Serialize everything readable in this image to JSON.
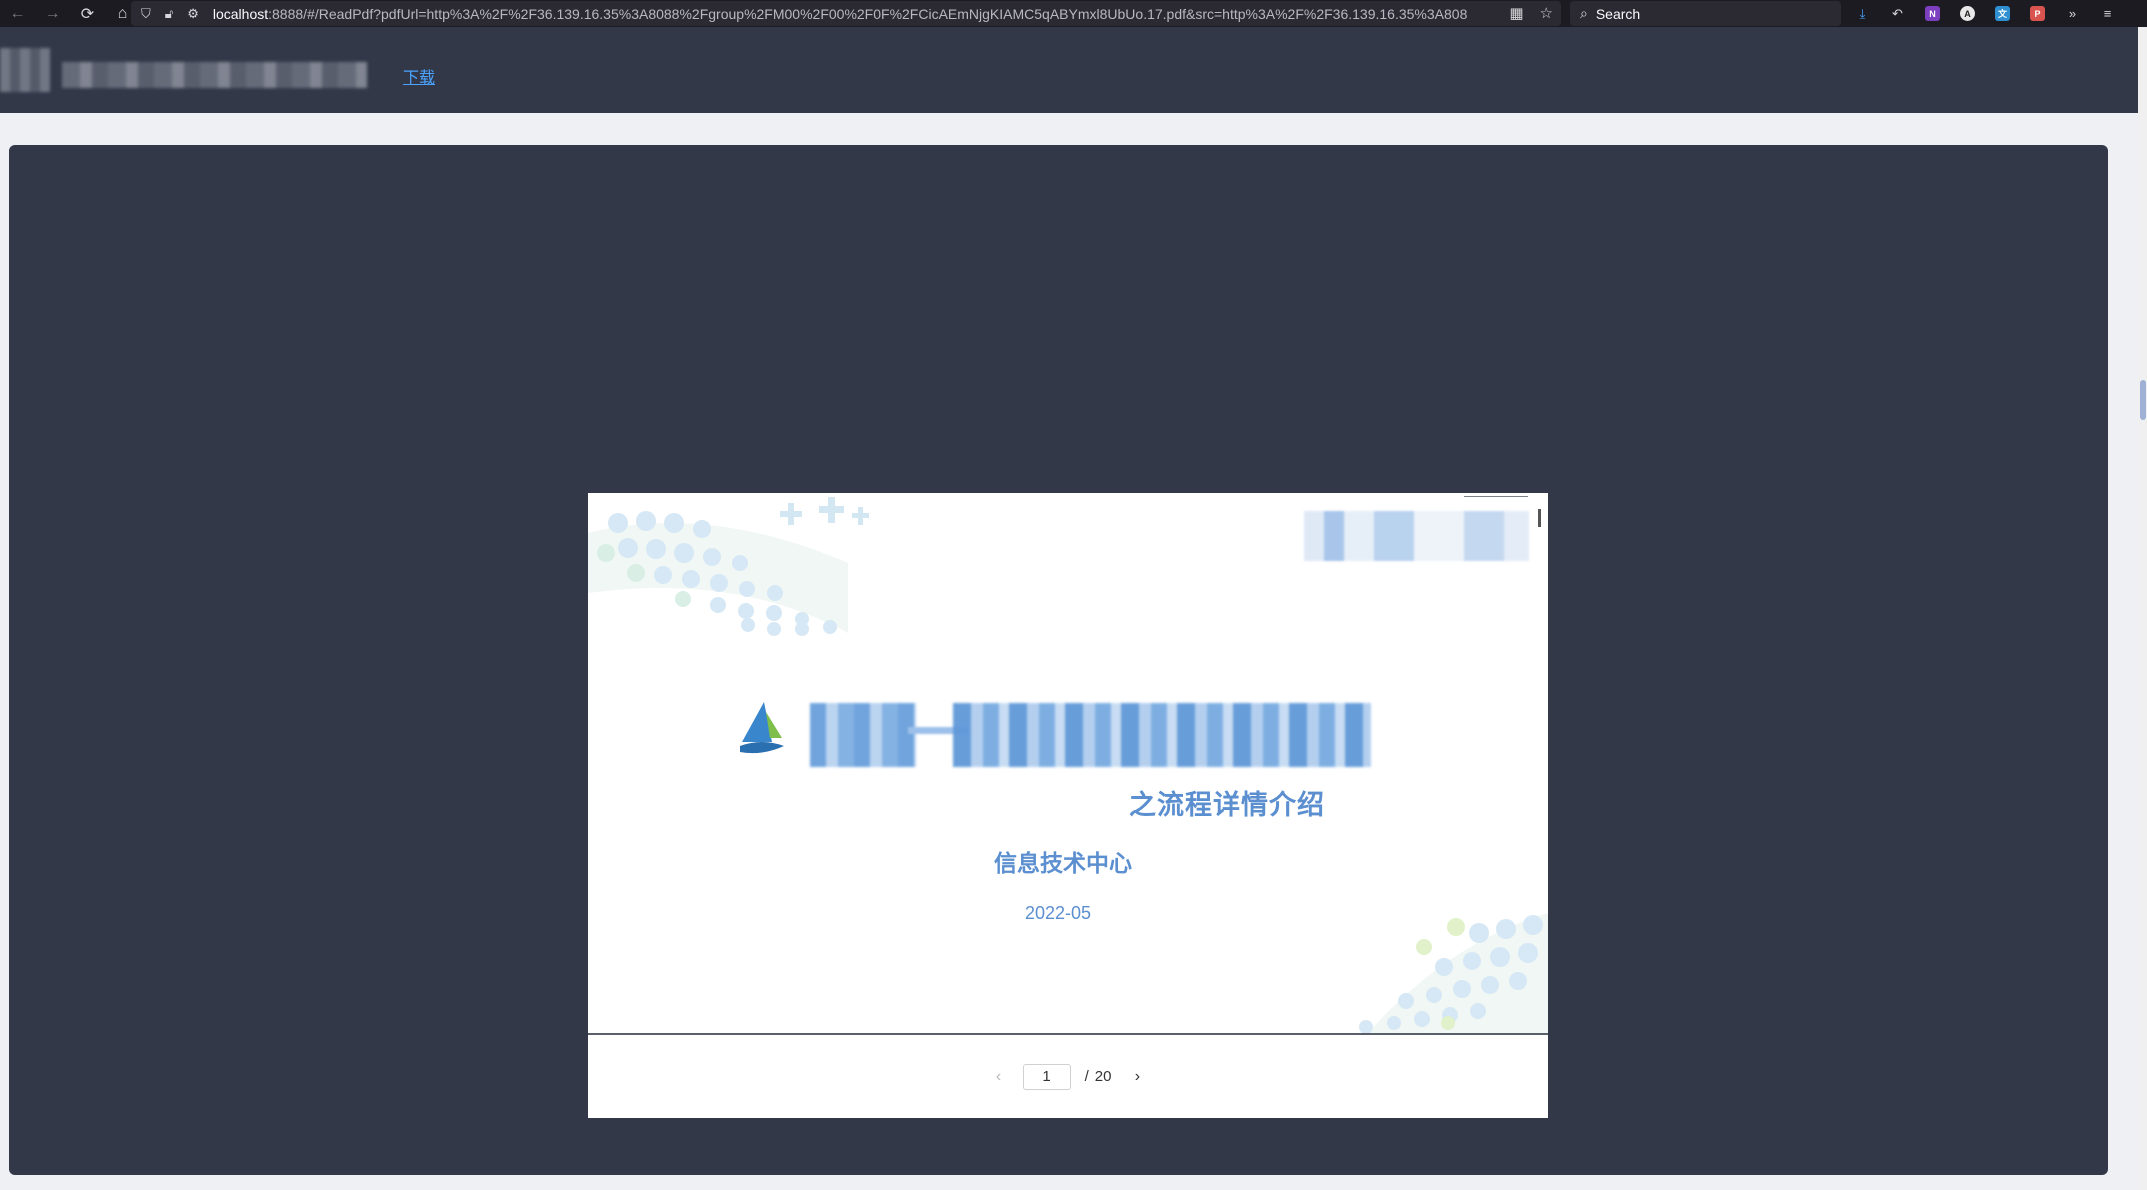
{
  "browser": {
    "url_host": "localhost",
    "url_rest": ":8888/#/ReadPdf?pdfUrl=http%3A%2F%2F36.139.16.35%3A8088%2Fgroup%2FM00%2F00%2F0F%2FCicAEmNjgKIAMC5qABYmxl8UbUo.17.pdf&src=http%3A%2F%2F36.139.16.35%3A808",
    "search_placeholder": "Search"
  },
  "header": {
    "download_label": "下载"
  },
  "slide": {
    "subtitle": "之流程详情介绍",
    "department": "信息技术中心",
    "date": "2022-05"
  },
  "pager": {
    "current_page": "1",
    "separator": "/",
    "total_pages": "20"
  },
  "colors": {
    "header_bg": "#323848",
    "slide_text": "#5b8fd0",
    "link": "#4aa3ff"
  }
}
